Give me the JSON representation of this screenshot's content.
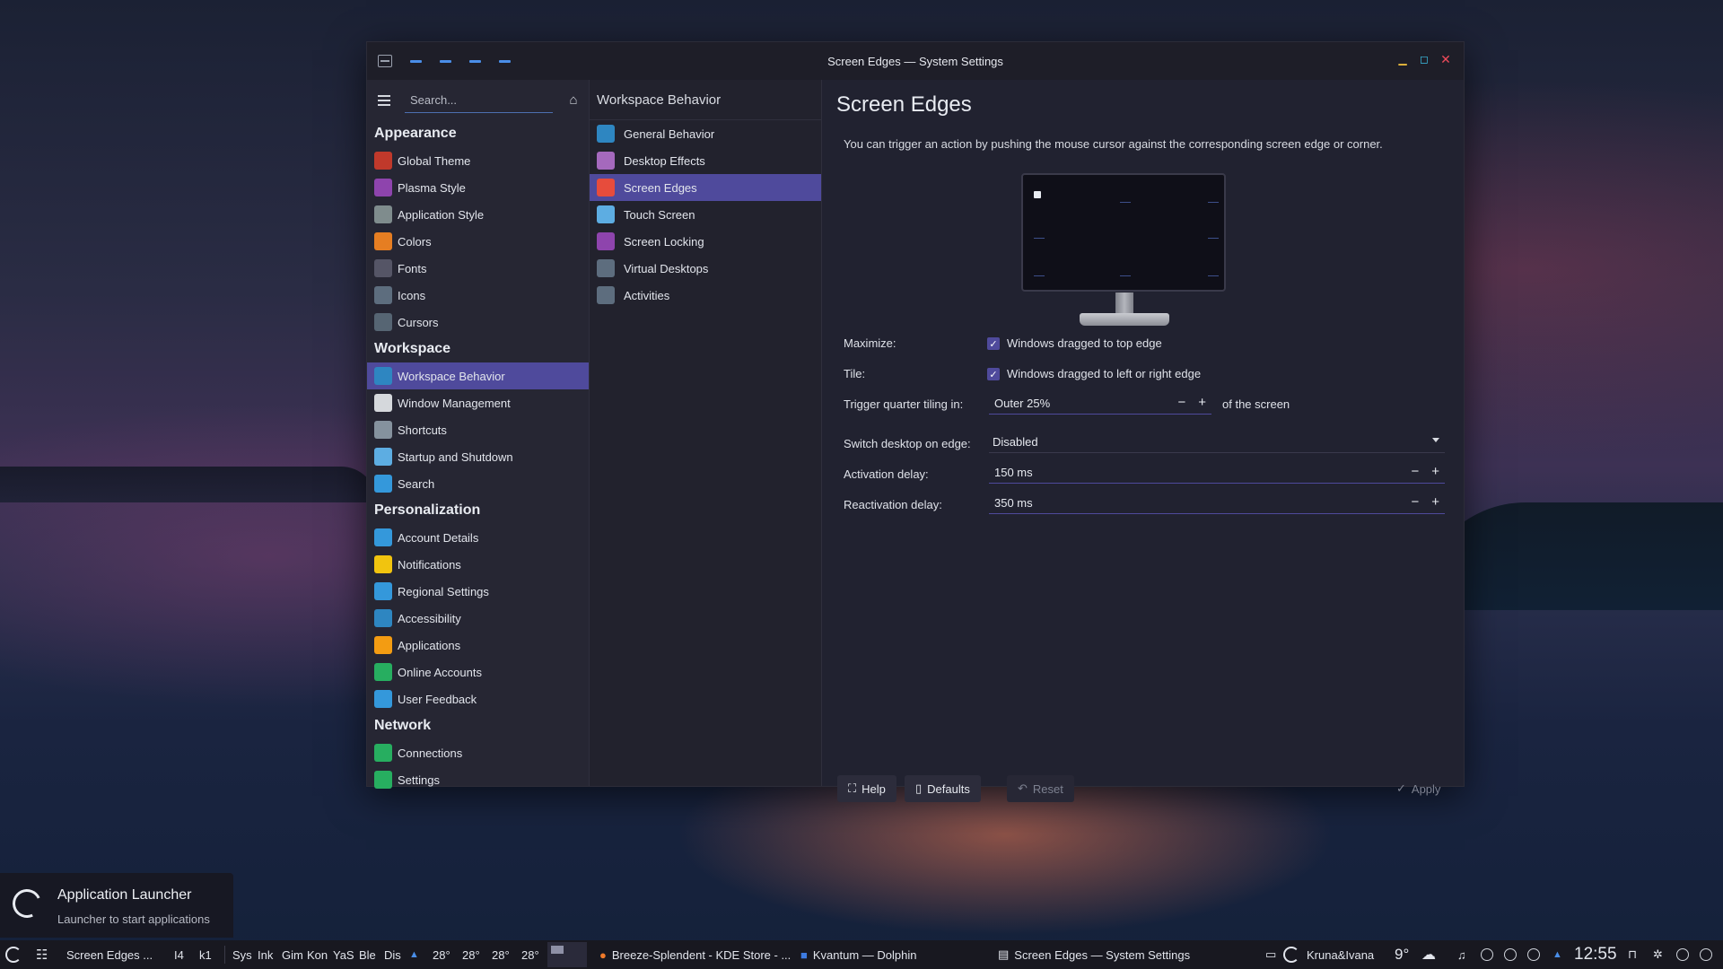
{
  "window": {
    "title": "Screen Edges — System Settings"
  },
  "sidebar": {
    "search_placeholder": "Search...",
    "sections": [
      {
        "title": "Appearance",
        "items": [
          {
            "label": "Global Theme",
            "icon": "global-theme-icon",
            "color": "#c0392b"
          },
          {
            "label": "Plasma Style",
            "icon": "plasma-style-icon",
            "color": "#8e44ad"
          },
          {
            "label": "Application Style",
            "icon": "application-style-icon",
            "color": "#7f8c8d"
          },
          {
            "label": "Colors",
            "icon": "colors-icon",
            "color": "#e67e22"
          },
          {
            "label": "Fonts",
            "icon": "fonts-icon",
            "color": "#555566"
          },
          {
            "label": "Icons",
            "icon": "icons-icon",
            "color": "#5d6d7e"
          },
          {
            "label": "Cursors",
            "icon": "cursors-icon",
            "color": "#566573"
          }
        ]
      },
      {
        "title": "Workspace",
        "items": [
          {
            "label": "Workspace Behavior",
            "icon": "workspace-behavior-icon",
            "color": "#2e86c1",
            "active": true
          },
          {
            "label": "Window Management",
            "icon": "window-management-icon",
            "color": "#d5d8dc"
          },
          {
            "label": "Shortcuts",
            "icon": "shortcuts-icon",
            "color": "#85929e"
          },
          {
            "label": "Startup and Shutdown",
            "icon": "startup-shutdown-icon",
            "color": "#5dade2"
          },
          {
            "label": "Search",
            "icon": "search-category-icon",
            "color": "#3498db"
          }
        ]
      },
      {
        "title": "Personalization",
        "items": [
          {
            "label": "Account Details",
            "icon": "account-details-icon",
            "color": "#3498db"
          },
          {
            "label": "Notifications",
            "icon": "notifications-icon",
            "color": "#f1c40f"
          },
          {
            "label": "Regional Settings",
            "icon": "regional-settings-icon",
            "color": "#3498db"
          },
          {
            "label": "Accessibility",
            "icon": "accessibility-icon",
            "color": "#2e86c1"
          },
          {
            "label": "Applications",
            "icon": "applications-icon",
            "color": "#f39c12"
          },
          {
            "label": "Online Accounts",
            "icon": "online-accounts-icon",
            "color": "#27ae60"
          },
          {
            "label": "User Feedback",
            "icon": "user-feedback-icon",
            "color": "#3498db"
          }
        ]
      },
      {
        "title": "Network",
        "items": [
          {
            "label": "Connections",
            "icon": "connections-icon",
            "color": "#27ae60"
          },
          {
            "label": "Settings",
            "icon": "network-settings-icon",
            "color": "#27ae60"
          }
        ]
      }
    ]
  },
  "subcategory": {
    "title": "Workspace Behavior",
    "items": [
      {
        "label": "General Behavior",
        "icon": "general-behavior-icon",
        "color": "#2e86c1"
      },
      {
        "label": "Desktop Effects",
        "icon": "desktop-effects-icon",
        "color": "#a569bd"
      },
      {
        "label": "Screen Edges",
        "icon": "screen-edges-icon",
        "color": "#e74c3c",
        "active": true
      },
      {
        "label": "Touch Screen",
        "icon": "touch-screen-icon",
        "color": "#5dade2"
      },
      {
        "label": "Screen Locking",
        "icon": "screen-locking-icon",
        "color": "#8e44ad"
      },
      {
        "label": "Virtual Desktops",
        "icon": "virtual-desktops-icon",
        "color": "#5d6d7e"
      },
      {
        "label": "Activities",
        "icon": "activities-icon",
        "color": "#5d6d7e"
      }
    ]
  },
  "main": {
    "title": "Screen Edges",
    "description": "You can trigger an action by pushing the mouse cursor against the corresponding screen edge or corner.",
    "maximize_label": "Maximize:",
    "maximize_check": "Windows dragged to top edge",
    "tile_label": "Tile:",
    "tile_check": "Windows dragged to left or right edge",
    "quarter_label": "Trigger quarter tiling in:",
    "quarter_value": "Outer 25%",
    "quarter_suffix": "of the screen",
    "switch_label": "Switch desktop on edge:",
    "switch_value": "Disabled",
    "activation_label": "Activation delay:",
    "activation_value": "150 ms",
    "reactivation_label": "Reactivation delay:",
    "reactivation_value": "350 ms",
    "minus": "−",
    "plus": "+"
  },
  "buttons": {
    "help": "Help",
    "defaults": "Defaults",
    "reset": "Reset",
    "apply": "Apply"
  },
  "launcher_tooltip": {
    "title": "Application Launcher",
    "subtitle": "Launcher to start applications"
  },
  "taskbar": {
    "task_screen_edges_short": "Screen Edges ...",
    "shortcuts": [
      "I4",
      "k1",
      "Sys",
      "Ink",
      "Gim",
      "Kon",
      "YaS",
      "Ble",
      "Dis"
    ],
    "temps": [
      "28°",
      "28°",
      "28°",
      "28°"
    ],
    "task_firefox": "Breeze-Splendent - KDE Store - ...",
    "task_dolphin": "Kvantum — Dolphin",
    "task_settings": "Screen Edges — System Settings",
    "user": "Kruna&Ivana",
    "weather": "9°",
    "clock": "12:55"
  }
}
